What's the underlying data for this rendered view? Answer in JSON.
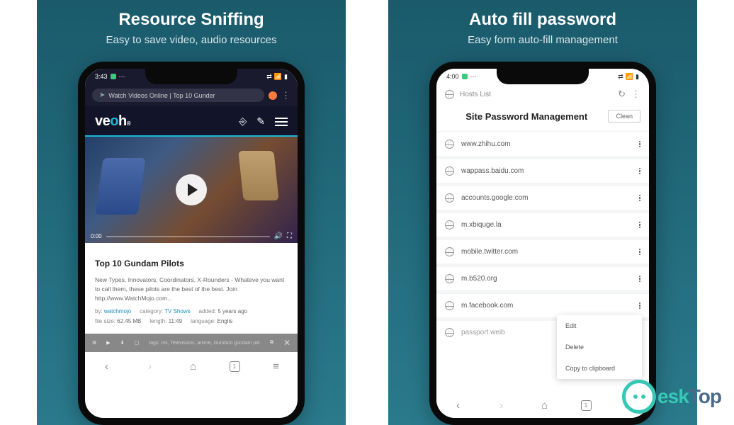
{
  "panels": {
    "left": {
      "title": "Resource Sniffing",
      "subtitle": "Easy to save video, audio resources"
    },
    "right": {
      "title": "Auto fill password",
      "subtitle": "Easy form auto-fill management"
    }
  },
  "phone1": {
    "status_time": "3:43",
    "address": "Watch Videos Online | Top 10 Gunder",
    "logo_pre": "ve",
    "logo_o": "o",
    "logo_post": "h",
    "video_time": "0:00",
    "article_title": "Top 10 Gundam Pilots",
    "article_desc": "New Types, Innovators, Coordinators, X-Rounders - Whateve you want to call them, these pilots are the best of the best. Join http://www.WatchMojo.com...",
    "meta": {
      "by_label": "by:",
      "by_value": "watchmojo",
      "cat_label": "category:",
      "cat_value": "TV Shows",
      "added_label": "added:",
      "added_value": "5 years ago",
      "size_label": "file size:",
      "size_value": "62.45 MB",
      "length_label": "length:",
      "length_value": "11:49",
      "lang_label": "language:",
      "lang_value": "Englis"
    },
    "grey_text": "tags: ms, Televisions, anime, Gundam gundam pilots",
    "tabs_count": "1"
  },
  "phone2": {
    "status_time": "4:00",
    "hosts_label": "Hosts List",
    "page_title": "Site Password Management",
    "clean_label": "Clean",
    "sites": [
      "www.zhihu.com",
      "wappass.baidu.com",
      "accounts.google.com",
      "m.xbiquge.la",
      "mobile.twitter.com",
      "m.b520.org",
      "m.facebook.com",
      "passport.weib"
    ],
    "popup": {
      "edit": "Edit",
      "delete": "Delete",
      "copy": "Copy to clipboard"
    },
    "tabs_count": "1"
  },
  "watermark": {
    "text1": "esk",
    "text2": "Top"
  }
}
